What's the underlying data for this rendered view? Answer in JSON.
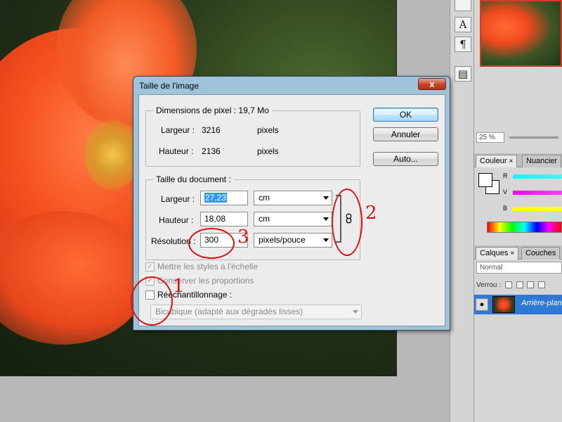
{
  "dialog": {
    "title": "Taille de l'image",
    "close_label": "x",
    "pixel_dimensions": {
      "label": "Dimensions de pixel :",
      "size": "19,7 Mo",
      "width_label": "Largeur :",
      "width_value": "3216",
      "width_unit": "pixels",
      "height_label": "Hauteur :",
      "height_value": "2136",
      "height_unit": "pixels"
    },
    "document_size": {
      "label": "Taille du document :",
      "width_label": "Largeur :",
      "width_value": "27,23",
      "width_unit": "cm",
      "height_label": "Hauteur :",
      "height_value": "18,08",
      "height_unit": "cm",
      "resolution_label": "Résolution :",
      "resolution_value": "300",
      "resolution_unit": "pixels/pouce"
    },
    "buttons": {
      "ok": "OK",
      "cancel": "Annuler",
      "auto": "Auto..."
    },
    "options": {
      "scale_styles": "Mettre les styles à l'échelle",
      "keep_proportions": "Conserver les proportions",
      "resample": "Rééchantillonnage :",
      "resample_method": "Bicubique (adapté aux dégradés lisses)"
    }
  },
  "annotations": [
    "1",
    "2",
    "3"
  ],
  "right_panel": {
    "zoom": "25 %",
    "color_tabs": [
      "Couleur",
      "Nuancier"
    ],
    "color_channels": [
      "R",
      "V",
      "B"
    ],
    "layers_tabs": [
      "Calques",
      "Couches"
    ],
    "blend_mode": "Normal",
    "lock_label": "Verrou :",
    "layer_name": "Arrière-plan",
    "tab_close": "×"
  },
  "colors": {
    "accent": "#2f78d6",
    "annotation": "#e01010",
    "dialog_frame": "#9fc3da"
  }
}
